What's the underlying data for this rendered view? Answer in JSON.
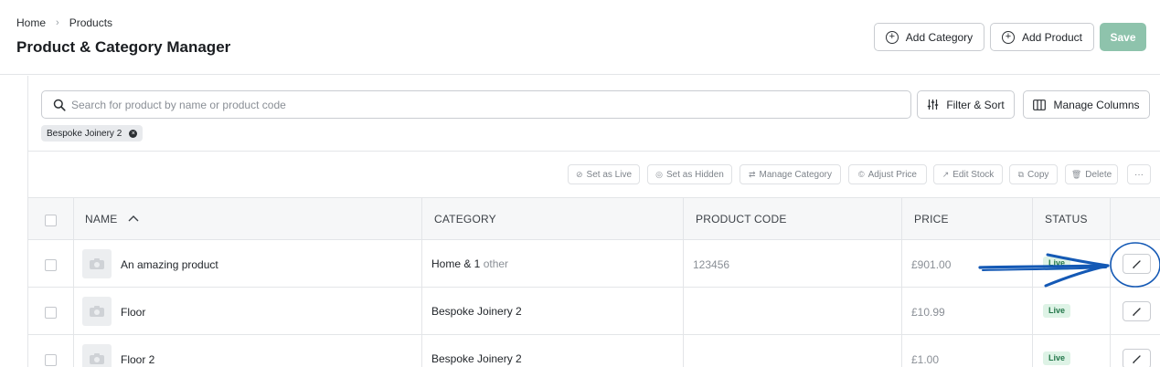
{
  "breadcrumb": {
    "home": "Home",
    "separator": "›",
    "current": "Products"
  },
  "page_title": "Product & Category Manager",
  "header_actions": {
    "add_category": "Add Category",
    "add_product": "Add Product",
    "save": "Save"
  },
  "search": {
    "placeholder": "Search for product by name or product code"
  },
  "toolbar": {
    "filter_sort": "Filter & Sort",
    "manage_columns": "Manage Columns"
  },
  "active_filter_chip": "Bespoke Joinery 2",
  "bulk_actions": {
    "set_live": "Set as Live",
    "set_hidden": "Set as Hidden",
    "manage_category": "Manage Category",
    "adjust_price": "Adjust Price",
    "edit_stock": "Edit Stock",
    "copy": "Copy",
    "delete": "Delete",
    "more": "···"
  },
  "table": {
    "columns": {
      "name": "NAME",
      "category": "CATEGORY",
      "product_code": "PRODUCT CODE",
      "price": "PRICE",
      "status": "STATUS"
    },
    "sort": {
      "column": "name",
      "direction": "ascending"
    },
    "rows": [
      {
        "name": "An amazing product",
        "category": "Home & 1",
        "category_extra": "other",
        "product_code": "123456",
        "price": "£901.00",
        "status": "Live"
      },
      {
        "name": "Floor",
        "category": "Bespoke Joinery 2",
        "category_extra": "",
        "product_code": "",
        "price": "£10.99",
        "status": "Live"
      },
      {
        "name": "Floor 2",
        "category": "Bespoke Joinery 2",
        "category_extra": "",
        "product_code": "",
        "price": "£1.00",
        "status": "Live"
      }
    ]
  },
  "colors": {
    "accent_save": "#8ec3ac",
    "live_badge_bg": "#def3e6",
    "live_badge_text": "#23774a",
    "annotation": "#1459b5"
  }
}
